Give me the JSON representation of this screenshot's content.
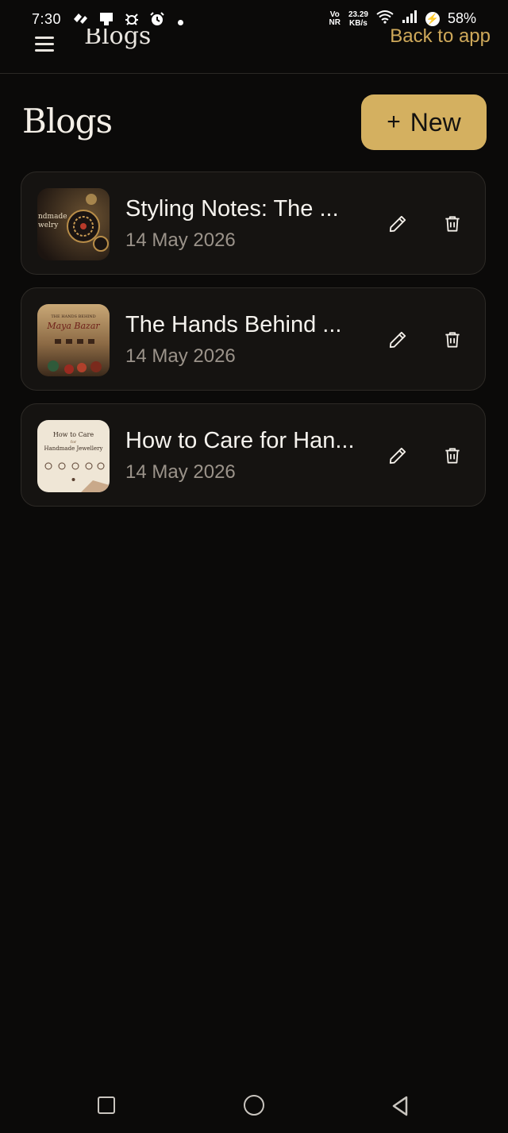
{
  "status_bar": {
    "time": "7:30",
    "volte_top": "Vo",
    "volte_bottom": "NR",
    "speed_value": "23.29",
    "speed_unit": "KB/s",
    "battery": "58%",
    "icons": [
      "app-icon-1",
      "app-icon-2",
      "bug-icon",
      "alarm-icon",
      "notification-dot",
      "wifi-icon",
      "signal-icon",
      "charging-icon"
    ]
  },
  "top_bar": {
    "title": "Blogs",
    "back_link": "Back to app"
  },
  "page": {
    "title": "Blogs",
    "new_button_label": "New",
    "new_button_icon": "plus-icon"
  },
  "posts": [
    {
      "title": "Styling Notes: The ...",
      "date": "14 May 2026",
      "thumb_text_1": "ndmade",
      "thumb_text_2": "welry"
    },
    {
      "title": "The Hands Behind ...",
      "date": "14 May 2026",
      "thumb_text_1": "THE HANDS BEHIND",
      "thumb_text_2": "Maya Bazar"
    },
    {
      "title": "How to Care for Han...",
      "date": "14 May 2026",
      "thumb_text_1": "How to Care",
      "thumb_text_2": "for",
      "thumb_text_3": "Handmade Jewellery"
    }
  ],
  "nav_bar": {
    "icons": [
      "recents-icon",
      "home-icon",
      "back-icon"
    ]
  },
  "colors": {
    "background": "#0b0a09",
    "card": "#151311",
    "accent": "#d4b060",
    "muted_text": "#9b938a"
  }
}
